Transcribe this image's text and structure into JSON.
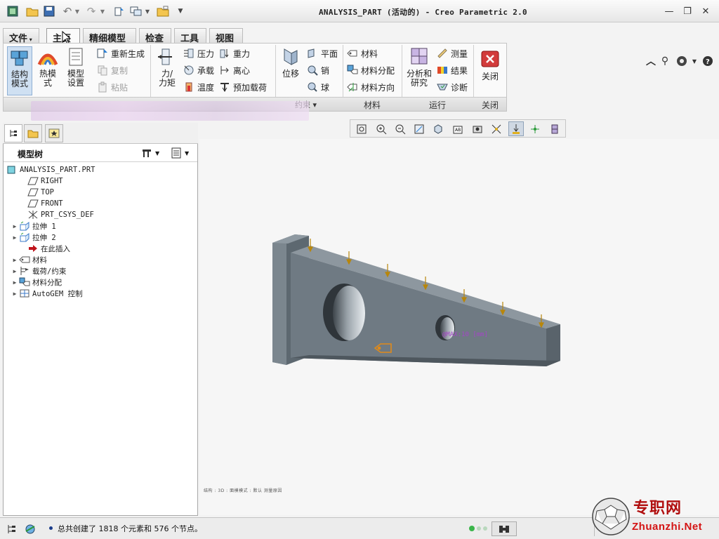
{
  "window": {
    "title": "ANALYSIS_PART (活动的) - Creo Parametric 2.0"
  },
  "tabs": [
    {
      "label": "文件",
      "has_dropdown": true
    },
    {
      "label": "主页",
      "active": true
    },
    {
      "label": "精细模型"
    },
    {
      "label": "检查"
    },
    {
      "label": "工具"
    },
    {
      "label": "视图"
    }
  ],
  "ribbon": {
    "structure_mode": "结构\n模式",
    "thermal_mode": "热模\n式",
    "model_setup": "模型\n设置",
    "regenerate": "重新生成",
    "copy": "复制",
    "paste": "粘贴",
    "force_moment": "力/\n力矩",
    "pressure": "压力",
    "bearing": "承载",
    "temperature": "温度",
    "gravity": "重力",
    "centrifugal": "离心",
    "preload": "预加载荷",
    "displacement": "位移",
    "plane": "平面",
    "pin": "销",
    "ball": "球",
    "material": "材料",
    "material_assignment": "材料分配",
    "material_orientation": "材料方向",
    "analysis_study": "分析和\n研究",
    "measure": "测量",
    "results": "结果",
    "diagnostics": "诊断",
    "close": "关闭",
    "groups": {
      "constraints_suffix": "约束",
      "materials": "材料",
      "run": "运行",
      "close": "关闭"
    }
  },
  "model_tree": {
    "title": "模型树",
    "items": [
      {
        "label": "ANALYSIS_PART.PRT",
        "icon": "part-icon",
        "level": 0
      },
      {
        "label": "RIGHT",
        "icon": "datum-plane-icon",
        "level": 1
      },
      {
        "label": "TOP",
        "icon": "datum-plane-icon",
        "level": 1
      },
      {
        "label": "FRONT",
        "icon": "datum-plane-icon",
        "level": 1
      },
      {
        "label": "PRT_CSYS_DEF",
        "icon": "csys-icon",
        "level": 1
      },
      {
        "label": "拉伸 1",
        "icon": "extrude-icon",
        "level": 1,
        "expandable": true
      },
      {
        "label": "拉伸 2",
        "icon": "extrude-icon",
        "level": 1,
        "expandable": true
      },
      {
        "label": "在此插入",
        "icon": "insert-arrow-icon",
        "level": 1
      },
      {
        "label": "材料",
        "icon": "material-icon",
        "level": 1,
        "expandable": true
      },
      {
        "label": "载荷/约束",
        "icon": "load-constraint-icon",
        "level": 1,
        "expandable": true
      },
      {
        "label": "材料分配",
        "icon": "material-assign-icon",
        "level": 1,
        "expandable": true
      },
      {
        "label": "AutoGEM 控制",
        "icon": "autogem-icon",
        "level": 1,
        "expandable": true
      }
    ]
  },
  "viewport": {
    "mesh_label": "@MAX:10 [mm]",
    "mini_legend": "结构 : 3D : 面模模式 : 默认 测量原因"
  },
  "status": {
    "message": "总共创建了 1818 个元素和 576 个节点。"
  },
  "watermark": {
    "brand_cn": "专职网",
    "brand_url": "Zhuanzhi.Net"
  },
  "colors": {
    "model_gray": "#6f7a83",
    "load_arrow": "#b8860b",
    "close_red": "#d23b3b",
    "tab_highlight": "#e05a5a"
  }
}
